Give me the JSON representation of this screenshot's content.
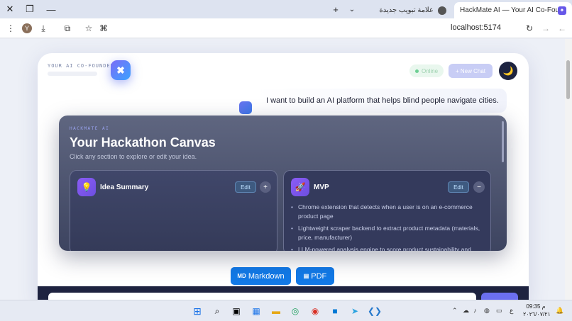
{
  "browser": {
    "tabs": [
      {
        "title": "HackMate AI — Your AI Co-Fou",
        "active": true
      },
      {
        "title": "علامة تبويب جديدة",
        "active": false
      }
    ],
    "new_tab": "+",
    "tab_search": "⌄",
    "window": {
      "close": "✕",
      "restore": "❐",
      "minimize": "—"
    },
    "url": "localhost:5174",
    "profile_initial": "Y"
  },
  "app": {
    "tagline": "YOUR AI CO-FOUNDER",
    "logo_glyph": "✖",
    "status": "Online",
    "new_chat": "+ New Chat",
    "theme_icon": "🌙",
    "user_message": "I want to build an AI platform that helps blind people navigate cities."
  },
  "canvas": {
    "kicker": "HACKMATE AI",
    "title": "Your Hackathon Canvas",
    "subtitle": "Click any section to explore or edit your idea.",
    "sections": [
      {
        "title": "Idea Summary",
        "icon": "bulb-icon",
        "edit": "Edit",
        "toggle": "+",
        "bullets": []
      },
      {
        "title": "MVP",
        "icon": "rocket-icon",
        "edit": "Edit",
        "toggle": "−",
        "bullets": [
          "Chrome extension that detects when a user is on an e-commerce product page",
          "Lightweight scraper backend to extract product metadata (materials, price, manufacturer)",
          "LLM-powered analysis engine to score product sustainability and"
        ]
      }
    ]
  },
  "export": {
    "markdown": "Markdown",
    "pdf": "PDF",
    "markdown_icon": "MD"
  },
  "taskbar": {
    "time": "09:35 م",
    "date": "٢٠٢٦/٠٧/٢١",
    "lang": "ع"
  },
  "colors": {
    "accent": "#1279e6",
    "canvas_bg": "#4a5070",
    "purple": "#8b5cf6"
  }
}
